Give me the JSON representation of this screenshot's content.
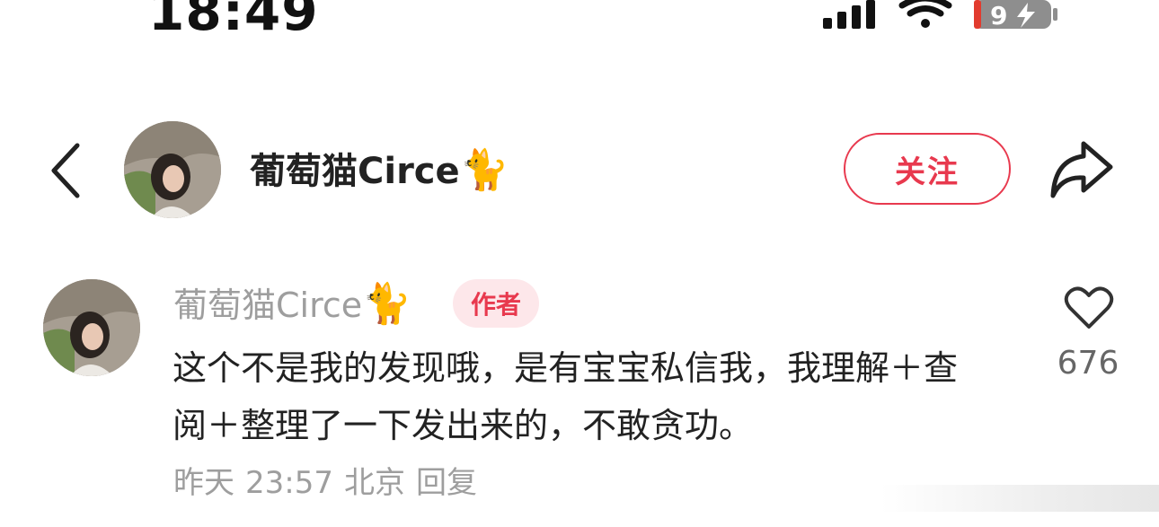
{
  "status_bar": {
    "time": "18:49",
    "battery_level": "9",
    "icons": [
      "signal-icon",
      "wifi-icon",
      "battery-icon"
    ]
  },
  "header": {
    "author_name": "葡萄猫Circe",
    "author_emoji": "🐈",
    "follow_label": "关注",
    "icons": [
      "back-chevron-icon",
      "share-icon"
    ]
  },
  "comment": {
    "author_name": "葡萄猫Circe",
    "author_emoji": "🐈",
    "badge": "作者",
    "text": "这个不是我的发现哦，是有宝宝私信我，我理解＋查阅＋整理了一下发出来的，不敢贪功。",
    "date": "昨天",
    "time": "23:57",
    "location": "北京",
    "reply_label": "回复",
    "like_count": "676"
  },
  "colors": {
    "accent": "#e8394e",
    "badge_bg": "#fde7ea",
    "muted_text": "#9e9e9e",
    "battery_red": "#e23b2e"
  }
}
